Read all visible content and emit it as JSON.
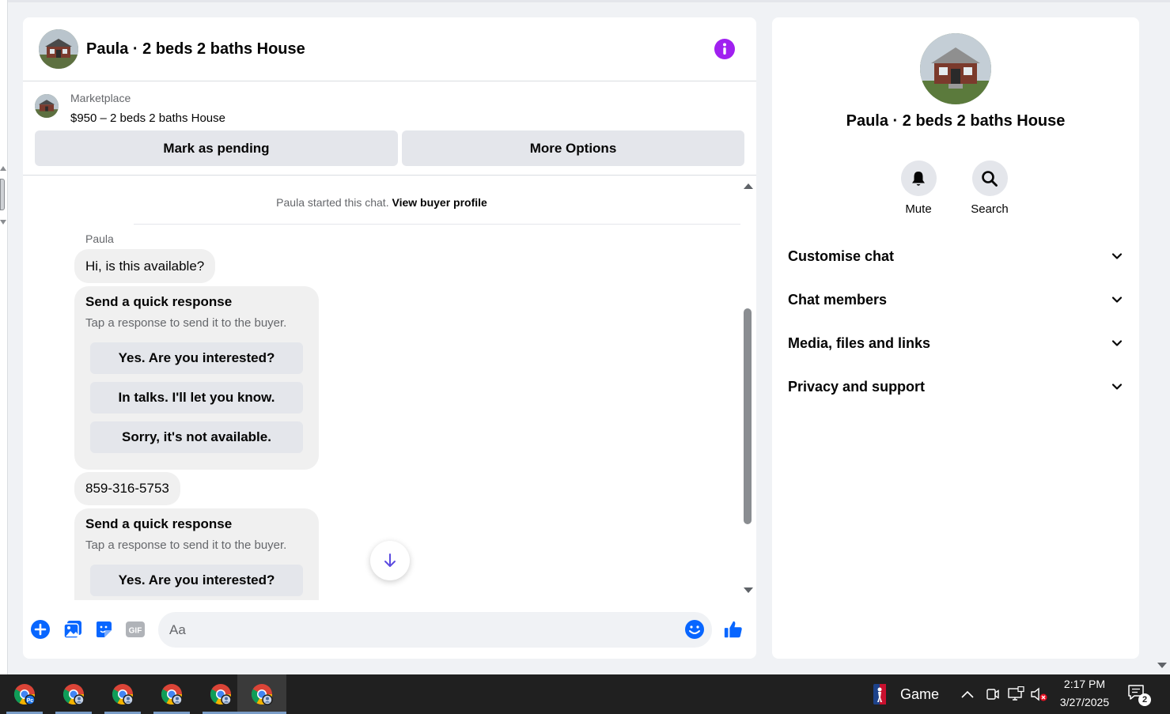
{
  "chat": {
    "title": "Paula · 2 beds 2 baths House",
    "listing": {
      "source": "Marketplace",
      "title": "$950 – 2 beds 2 baths House",
      "mark_pending_label": "Mark as pending",
      "more_options_label": "More Options"
    },
    "started_text": "Paula started this chat.",
    "view_profile_label": "View buyer profile",
    "sender": "Paula",
    "messages": {
      "first": "Hi, is this available?",
      "phone": "859-316-5753"
    },
    "quick_response": {
      "title": "Send a quick response",
      "subtitle": "Tap a response to send it to the buyer.",
      "options": [
        "Yes. Are you interested?",
        "In talks. I'll let you know.",
        "Sorry, it's not available."
      ]
    },
    "composer": {
      "placeholder": "Aa"
    }
  },
  "side": {
    "title": "Paula · 2 beds 2 baths House",
    "actions": {
      "mute": "Mute",
      "search": "Search"
    },
    "sections": [
      "Customise chat",
      "Chat members",
      "Media, files and links",
      "Privacy and support"
    ]
  },
  "taskbar": {
    "widget_label": "Game",
    "time": "2:17 PM",
    "date": "3/27/2025",
    "notification_count": "2"
  },
  "colors": {
    "accent": "#0866ff",
    "info": "#a020f0",
    "taskbar": "#202020"
  }
}
